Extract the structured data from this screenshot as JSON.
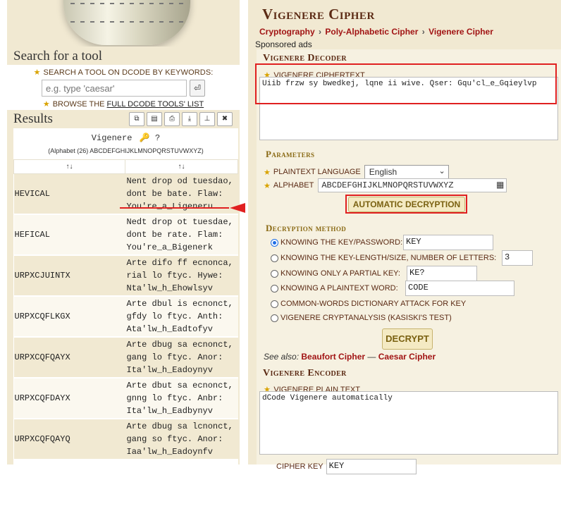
{
  "sidebar": {
    "search_title": "Search for a tool",
    "search_keywords_label": "SEARCH A TOOL ON DCODE BY KEYWORDS:",
    "search_placeholder": "e.g. type 'caesar'",
    "browse_prefix": "BROWSE THE",
    "browse_link": "FULL DCODE TOOLS' LIST",
    "results_title": "Results",
    "results_tool_name": "Vigenere",
    "results_tool_icons": "🔑 ?",
    "alphabet_line": "(Alphabet (26) ABCDEFGHIJKLMNOPQRSTUVWXYZ)",
    "column_headers": [
      "↑↓",
      "↑↓"
    ],
    "rows": [
      {
        "key": "HEVICAL",
        "text": "Nent drop od tuesdao,\ndont be bate. Flaw:\nYou're_a_Ligeneru"
      },
      {
        "key": "HEFICAL",
        "text": "Nedt drop ot tuesdae,\ndont be rate. Flam:\nYou're_a_Bigenerk"
      },
      {
        "key": "URPXCJUINTX",
        "text": "Arte difo ff ecnonca,\nrial lo ftyc. Hywe:\nNta'lw_h_Ehowlsyv"
      },
      {
        "key": "URPXCQFLKGX",
        "text": "Arte dbul is ecnonct,\ngfdy lo ftyc. Anth:\nAta'lw_h_Eadtofyv"
      },
      {
        "key": "URPXCQFQAYX",
        "text": "Arte dbug sa ecnonct,\ngang lo ftyc. Anor:\nIta'lw_h_Eadoynyv"
      },
      {
        "key": "URPXCQFDAYX",
        "text": "Arte dbut sa ecnonct,\ngnng lo ftyc. Anbr:\nIta'lw_h_Eadbynyv"
      },
      {
        "key": "URPXCQFQAYQ",
        "text": "Arte dbug sa lcnonct,\ngang so ftyc. Anor:\nIaa'lw_h_Eadoynfv"
      }
    ]
  },
  "page": {
    "title": "Vigenere Cipher",
    "breadcrumb": [
      "Cryptography",
      "Poly-Alphabetic Cipher",
      "Vigenere Cipher"
    ],
    "sponsored": "Sponsored ads"
  },
  "decoder": {
    "title": "Vigenere Decoder",
    "ciphertext_label": "VIGENERE CIPHERTEXT",
    "ciphertext_value": "Uiib frzw sy bwedkej, lqne ii wive. Qser: Gqu'cl_e_Gqieylvp",
    "parameters_title": "Parameters",
    "plaintext_language_label": "PLAINTEXT LANGUAGE",
    "plaintext_language_value": "English",
    "alphabet_label": "ALPHABET",
    "alphabet_value": "ABCDEFGHIJKLMNOPQRSTUVWXYZ",
    "auto_button": "AUTOMATIC DECRYPTION",
    "method_title": "Decryption method",
    "methods": [
      {
        "label": "KNOWING THE KEY/PASSWORD:",
        "value": "KEY",
        "selected": true
      },
      {
        "label": "KNOWING THE KEY-LENGTH/SIZE, NUMBER OF LETTERS:",
        "value": "3",
        "selected": false
      },
      {
        "label": "KNOWING ONLY A PARTIAL KEY:",
        "value": "KE?",
        "selected": false
      },
      {
        "label": "KNOWING A PLAINTEXT WORD:",
        "value": "CODE",
        "selected": false
      },
      {
        "label": "COMMON-WORDS DICTIONARY ATTACK FOR KEY",
        "value": "",
        "selected": false
      },
      {
        "label": "VIGENERE CRYPTANALYSIS (KASISKI'S TEST)",
        "value": "",
        "selected": false
      }
    ],
    "decrypt_button": "DECRYPT",
    "see_also_prefix": "See also:",
    "see_also_links": [
      "Beaufort Cipher",
      "Caesar Cipher"
    ],
    "see_also_sep": "—"
  },
  "encoder": {
    "title": "Vigenere Encoder",
    "plaintext_label": "VIGENERE PLAIN TEXT",
    "plaintext_value": "dCode Vigenere automatically",
    "cipher_key_label": "CIPHER KEY",
    "cipher_key_value": "KEY"
  },
  "colors": {
    "accent_red": "#e02020",
    "brand_brown": "#5b2a14",
    "link_red": "#a11414",
    "panel_bg": "#f1e9d2"
  }
}
